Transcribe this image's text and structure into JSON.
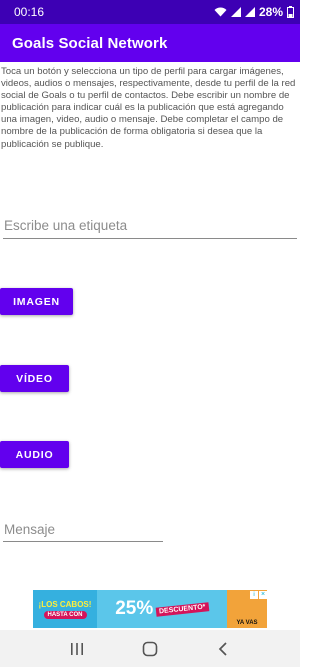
{
  "status_bar": {
    "time": "00:16",
    "battery": "28%"
  },
  "app_bar": {
    "title": "Goals Social Network"
  },
  "instructions": {
    "text": "Toca un botón y selecciona un tipo de perfil para cargar imágenes, videos, audios o mensajes, respectivamente, desde tu perfil de la red social de Goals o tu perfil de contactos. Debe escribir un nombre de publicación para indicar cuál es la publicación que está agregando una imagen, video, audio o mensaje. Debe completar el campo de nombre de la publicación de forma obligatoria si desea que la publicación se publique."
  },
  "tag_field": {
    "value": "",
    "placeholder": "Escribe una etiqueta"
  },
  "buttons": {
    "image_label": "IMAGEN",
    "video_label": "VÍDEO",
    "audio_label": "AUDIO"
  },
  "message_field": {
    "value": "",
    "placeholder": "Mensaje"
  },
  "ad": {
    "headline": "¡LOS CABOS!",
    "subline": "HASTA CON",
    "percent": "25%",
    "discount": "DESCUENTO*",
    "brand": "YA VAS",
    "info_glyph": "i",
    "close_glyph": "×"
  },
  "colors": {
    "status_bar": "#3d00b4",
    "primary": "#6200ee",
    "background": "#ffffff"
  },
  "icons": {
    "status": [
      "wifi-icon",
      "lte-signal-icon",
      "signal-icon",
      "battery-icon"
    ],
    "navigation": [
      "recent-apps-icon",
      "home-icon",
      "back-icon"
    ]
  }
}
